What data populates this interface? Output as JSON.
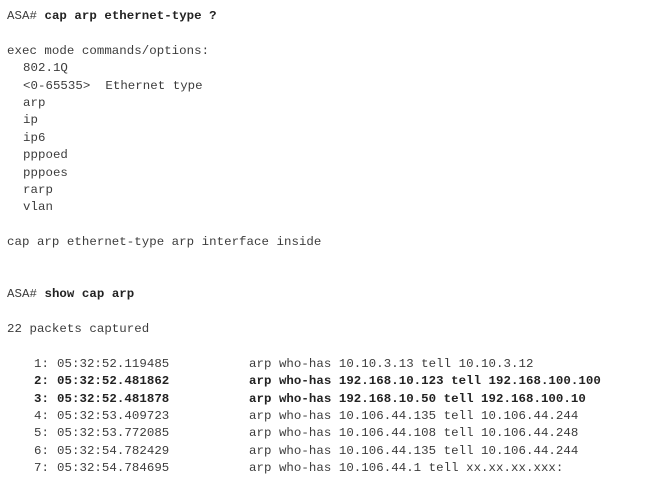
{
  "session1": {
    "prompt": "ASA#",
    "command": "cap arp ethernet-type ?",
    "header": "exec mode commands/options:",
    "options": [
      "802.1Q",
      "<0-65535>  Ethernet type",
      "arp",
      "ip",
      "ip6",
      "pppoed",
      "pppoes",
      "rarp",
      "vlan"
    ],
    "example": "cap arp ethernet-type arp interface inside"
  },
  "session2": {
    "prompt": "ASA#",
    "command": "show cap arp",
    "summary": "22 packets captured",
    "packets": [
      {
        "num": "1:",
        "time": "05:32:52.119485",
        "desc": "arp who-has 10.10.3.13 tell 10.10.3.12",
        "bold": false
      },
      {
        "num": "2:",
        "time": "05:32:52.481862",
        "desc": "arp who-has 192.168.10.123 tell 192.168.100.100",
        "bold": true
      },
      {
        "num": "3:",
        "time": "05:32:52.481878",
        "desc": "arp who-has 192.168.10.50 tell 192.168.100.10",
        "bold": true
      },
      {
        "num": "4:",
        "time": "05:32:53.409723",
        "desc": "arp who-has 10.106.44.135 tell 10.106.44.244",
        "bold": false
      },
      {
        "num": "5:",
        "time": "05:32:53.772085",
        "desc": "arp who-has 10.106.44.108 tell 10.106.44.248",
        "bold": false
      },
      {
        "num": "6:",
        "time": "05:32:54.782429",
        "desc": "arp who-has 10.106.44.135 tell 10.106.44.244",
        "bold": false
      },
      {
        "num": "7:",
        "time": "05:32:54.784695",
        "desc": "arp who-has 10.106.44.1 tell xx.xx.xx.xxx:",
        "bold": false
      }
    ]
  }
}
